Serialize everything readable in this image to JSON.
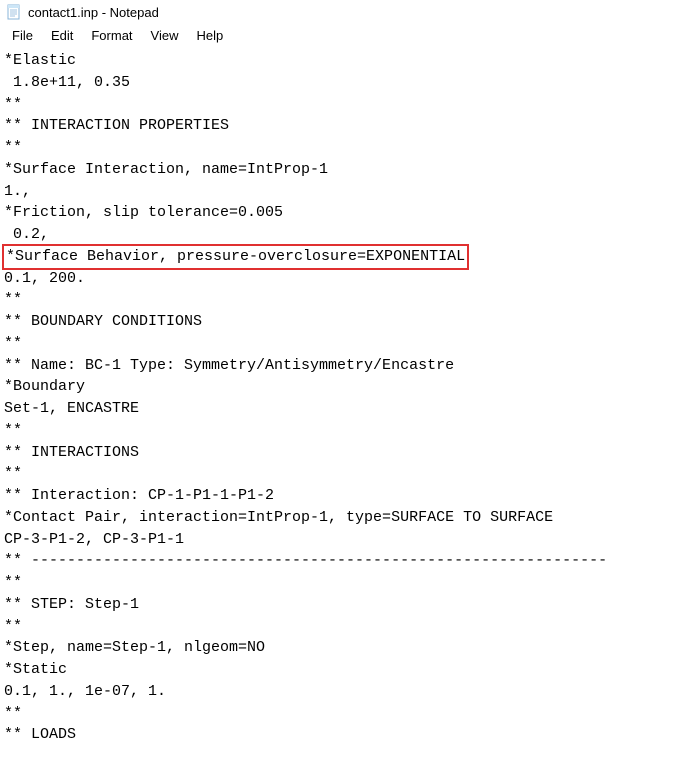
{
  "window": {
    "title": "contact1.inp - Notepad"
  },
  "menu": {
    "file": "File",
    "edit": "Edit",
    "format": "Format",
    "view": "View",
    "help": "Help"
  },
  "content": {
    "lines": [
      "*Elastic",
      " 1.8e+11, 0.35",
      "**",
      "** INTERACTION PROPERTIES",
      "**",
      "*Surface Interaction, name=IntProp-1",
      "1.,",
      "*Friction, slip tolerance=0.005",
      " 0.2,",
      "*Surface Behavior, pressure-overclosure=EXPONENTIAL",
      "0.1, 200.",
      "**",
      "** BOUNDARY CONDITIONS",
      "**",
      "** Name: BC-1 Type: Symmetry/Antisymmetry/Encastre",
      "*Boundary",
      "Set-1, ENCASTRE",
      "**",
      "** INTERACTIONS",
      "**",
      "** Interaction: CP-1-P1-1-P1-2",
      "*Contact Pair, interaction=IntProp-1, type=SURFACE TO SURFACE",
      "CP-3-P1-2, CP-3-P1-1",
      "** ----------------------------------------------------------------",
      "**",
      "** STEP: Step-1",
      "**",
      "*Step, name=Step-1, nlgeom=NO",
      "*Static",
      "0.1, 1., 1e-07, 1.",
      "**",
      "** LOADS"
    ],
    "highlighted_index": 9
  }
}
